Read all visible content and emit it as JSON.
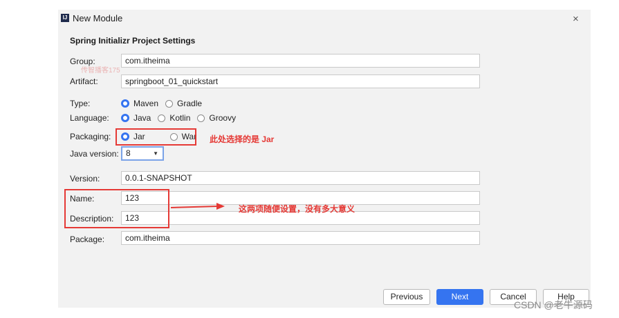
{
  "dialog": {
    "title": "New Module",
    "close_glyph": "×",
    "icon": "intellij-icon"
  },
  "section_title": "Spring Initializr Project Settings",
  "fields": {
    "group": {
      "label": "Group:",
      "value": "com.itheima"
    },
    "artifact": {
      "label": "Artifact:",
      "value": "springboot_01_quickstart"
    },
    "version": {
      "label": "Version:",
      "value": "0.0.1-SNAPSHOT"
    },
    "name": {
      "label": "Name:",
      "value": "123"
    },
    "description": {
      "label": "Description:",
      "value": "123"
    },
    "package": {
      "label": "Package:",
      "value": "com.itheima"
    }
  },
  "type": {
    "label": "Type:",
    "options": [
      "Maven",
      "Gradle"
    ],
    "selected": "Maven"
  },
  "language": {
    "label": "Language:",
    "options": [
      "Java",
      "Kotlin",
      "Groovy"
    ],
    "selected": "Java"
  },
  "packaging": {
    "label": "Packaging:",
    "options": [
      "Jar",
      "War"
    ],
    "selected": "Jar"
  },
  "java_version": {
    "label": "Java version:",
    "value": "8"
  },
  "buttons": {
    "previous": "Previous",
    "next": "Next",
    "cancel": "Cancel",
    "help": "Help"
  },
  "annotations": {
    "packaging_note": "此处选择的是 Jar",
    "name_desc_note": "这两项随便设置，没有多大意义",
    "color": "#e53935"
  },
  "watermarks": {
    "small": "传智播客175",
    "csdn": "CSDN @老牛源码"
  },
  "colors": {
    "accent": "#3574f0",
    "dialog_bg": "#f2f2f2"
  }
}
